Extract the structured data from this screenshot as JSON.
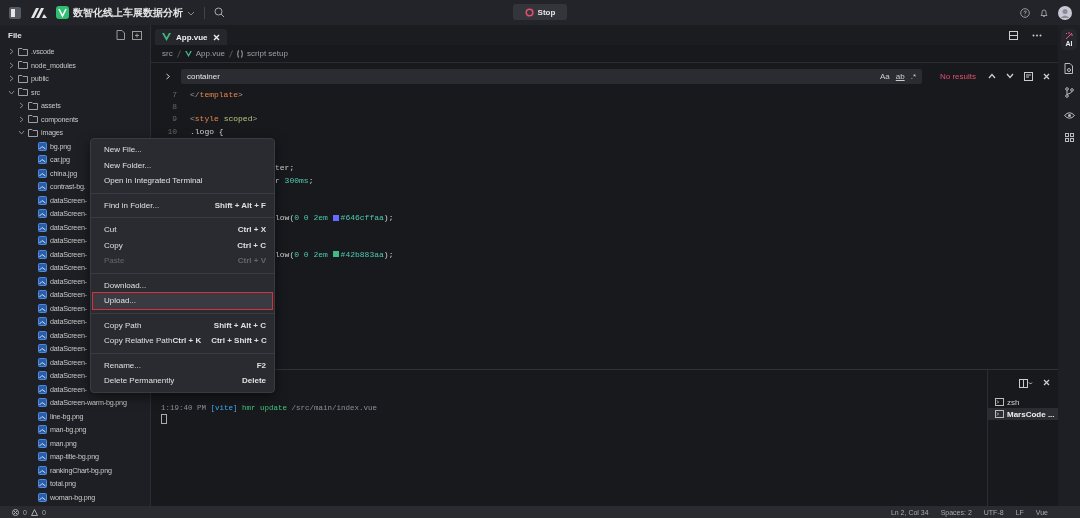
{
  "top_bar": {
    "project": "数智化线上车展数据分析",
    "stop_button": "Stop"
  },
  "sidebar": {
    "title": "File",
    "tree": [
      {
        "label": ".vscode",
        "kind": "folder",
        "expanded": false
      },
      {
        "label": "node_modules",
        "kind": "folder",
        "expanded": false
      },
      {
        "label": "public",
        "kind": "folder",
        "expanded": false
      },
      {
        "label": "src",
        "kind": "folder",
        "expanded": true,
        "children": [
          {
            "label": "assets",
            "kind": "folder",
            "expanded": false
          },
          {
            "label": "components",
            "kind": "folder",
            "expanded": false
          },
          {
            "label": "images",
            "kind": "folder",
            "expanded": true,
            "children": [
              {
                "label": "bg.png",
                "kind": "image"
              },
              {
                "label": "car.jpg",
                "kind": "image"
              },
              {
                "label": "china.jpg",
                "kind": "image"
              },
              {
                "label": "contrast-bg.",
                "kind": "image"
              },
              {
                "label": "dataScreen-",
                "kind": "image"
              },
              {
                "label": "dataScreen-",
                "kind": "image"
              },
              {
                "label": "dataScreen-",
                "kind": "image"
              },
              {
                "label": "dataScreen-",
                "kind": "image"
              },
              {
                "label": "dataScreen-",
                "kind": "image"
              },
              {
                "label": "dataScreen-",
                "kind": "image"
              },
              {
                "label": "dataScreen-",
                "kind": "image"
              },
              {
                "label": "dataScreen-",
                "kind": "image"
              },
              {
                "label": "dataScreen-",
                "kind": "image"
              },
              {
                "label": "dataScreen-",
                "kind": "image"
              },
              {
                "label": "dataScreen-",
                "kind": "image"
              },
              {
                "label": "dataScreen-",
                "kind": "image"
              },
              {
                "label": "dataScreen-",
                "kind": "image"
              },
              {
                "label": "dataScreen-",
                "kind": "image"
              },
              {
                "label": "dataScreen-",
                "kind": "image"
              },
              {
                "label": "dataScreen-warm-bg.png",
                "kind": "image"
              },
              {
                "label": "line-bg.png",
                "kind": "image"
              },
              {
                "label": "man-bg.png",
                "kind": "image"
              },
              {
                "label": "man.png",
                "kind": "image"
              },
              {
                "label": "map-title-bg.png",
                "kind": "image"
              },
              {
                "label": "rankingChart-bg.png",
                "kind": "image"
              },
              {
                "label": "total.png",
                "kind": "image"
              },
              {
                "label": "woman-bg.png",
                "kind": "image"
              }
            ]
          }
        ]
      }
    ]
  },
  "context_menu": {
    "groups": [
      [
        {
          "label": "New File...",
          "disabled": false,
          "selected": false
        },
        {
          "label": "New Folder...",
          "disabled": false,
          "selected": false
        },
        {
          "label": "Open in Integrated Terminal",
          "disabled": false,
          "selected": false
        }
      ],
      [
        {
          "label": "Find in Folder...",
          "shortcuts": [
            "Shift + Alt + F"
          ],
          "disabled": false,
          "selected": false
        }
      ],
      [
        {
          "label": "Cut",
          "shortcuts": [
            "Ctrl + X"
          ],
          "disabled": false,
          "selected": false
        },
        {
          "label": "Copy",
          "shortcuts": [
            "Ctrl + C"
          ],
          "disabled": false,
          "selected": false
        },
        {
          "label": "Paste",
          "shortcuts": [
            "Ctrl + V"
          ],
          "disabled": true,
          "selected": false
        }
      ],
      [
        {
          "label": "Download...",
          "disabled": false,
          "selected": false
        },
        {
          "label": "Upload...",
          "disabled": false,
          "selected": true
        }
      ],
      [
        {
          "label": "Copy Path",
          "shortcuts": [
            "Shift + Alt + C"
          ],
          "disabled": false,
          "selected": false
        },
        {
          "label": "Copy Relative Path",
          "shortcuts": [
            "Ctrl + K",
            "Ctrl + Shift + C"
          ],
          "disabled": false,
          "selected": false
        }
      ],
      [
        {
          "label": "Rename...",
          "shortcuts": [
            "F2"
          ],
          "disabled": false,
          "selected": false
        },
        {
          "label": "Delete Permanently",
          "shortcuts": [
            "Delete"
          ],
          "disabled": false,
          "selected": false
        }
      ]
    ]
  },
  "editor": {
    "tab": "App.vue",
    "breadcrumb": [
      "src",
      "App.vue",
      "script setup"
    ],
    "find": {
      "value": "container",
      "options": [
        "Aa",
        "ab",
        ".*"
      ],
      "result": "No results"
    },
    "lines": [
      {
        "number": "7",
        "tokens": [
          {
            "text": "</",
            "kind": "punct"
          },
          {
            "text": "template",
            "kind": "tag"
          },
          {
            "text": ">",
            "kind": "punct"
          }
        ]
      },
      {
        "number": "8"
      },
      {
        "number": "9",
        "tokens": [
          {
            "text": "<",
            "kind": "punct"
          },
          {
            "text": "style",
            "kind": "tag"
          },
          {
            "text": " scoped",
            "kind": "attr"
          },
          {
            "text": ">",
            "kind": "punct"
          }
        ]
      },
      {
        "number": "10",
        "tokens": [
          {
            "text": ".logo {",
            "kind": "plain"
          }
        ]
      }
    ],
    "fragments": [
      {
        "tokens": [
          {
            "text": "ter;",
            "kind": "plain"
          }
        ]
      },
      {
        "tokens": [
          {
            "text": "r ",
            "kind": "plain"
          },
          {
            "text": "300ms",
            "kind": "number"
          },
          {
            "text": ";",
            "kind": "plain"
          }
        ]
      },
      {
        "tokens": [
          {
            "text": "low(",
            "kind": "plain"
          },
          {
            "text": "0 0 2em ",
            "kind": "number"
          },
          {
            "text": "#646cffaa",
            "kind": "swatch",
            "color": "#646cff"
          },
          {
            "text": ");",
            "kind": "plain"
          }
        ]
      },
      {
        "tokens": [
          {
            "text": "low(",
            "kind": "plain"
          },
          {
            "text": "0 0 2em ",
            "kind": "number"
          },
          {
            "text": "#42b883aa",
            "kind": "swatch",
            "color": "#42b883"
          },
          {
            "text": ");",
            "kind": "plain"
          }
        ]
      }
    ]
  },
  "terminal": {
    "line": [
      {
        "text": "1:19:40 PM ",
        "kind": "dim"
      },
      {
        "text": "[vite]",
        "kind": "vite"
      },
      {
        "text": " hmr update ",
        "kind": "green"
      },
      {
        "text": "/src/main/index.vue",
        "kind": "dim"
      }
    ],
    "sessions": [
      {
        "label": "zsh",
        "selected": false
      },
      {
        "label": "MarsCode ...",
        "selected": true
      }
    ]
  },
  "right_rail": {
    "ai_label": "AI"
  },
  "status_bar": {
    "errors": "0",
    "warnings": "0",
    "items": [
      "Ln 2, Col 34",
      "Spaces: 2",
      "UTF-8",
      "LF",
      "Vue"
    ]
  }
}
